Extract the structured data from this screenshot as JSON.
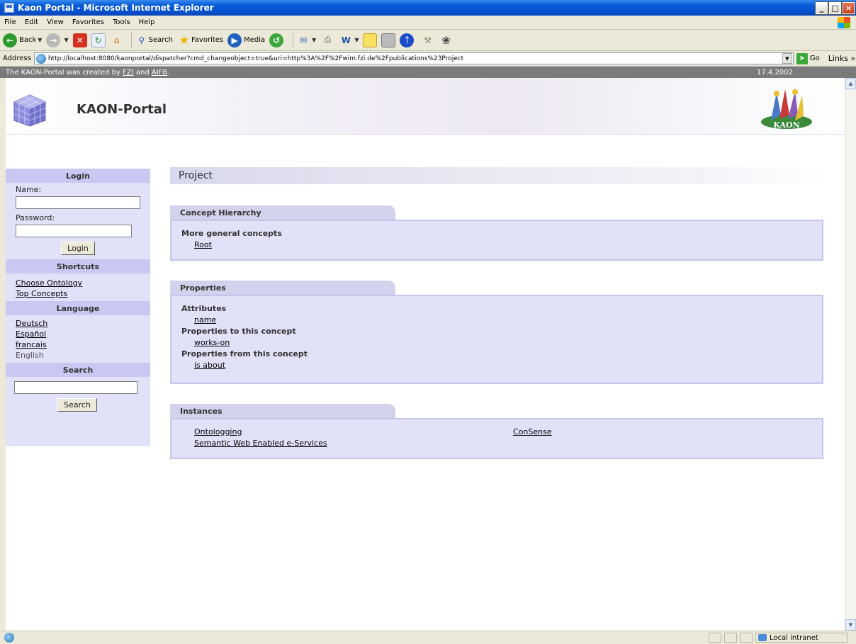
{
  "window": {
    "title": "Kaon Portal - Microsoft Internet Explorer",
    "buttons": [
      "_",
      "□",
      "×"
    ]
  },
  "menu": [
    "File",
    "Edit",
    "View",
    "Favorites",
    "Tools",
    "Help"
  ],
  "toolbar": {
    "back": "Back",
    "search": "Search",
    "favorites": "Favorites",
    "media": "Media"
  },
  "address": {
    "label": "Address",
    "url": "http://localhost:8080/kaonportal/dispatcher?cmd_changeobject=true&uri=http%3A%2F%2Fwim.fzi.de%2Fpublications%23Project",
    "go": "Go",
    "links": "Links »"
  },
  "strip": {
    "prefix": "The KAON-Portal was created by",
    "fzi": "FZI",
    "and": "and",
    "aifb": "AIFB",
    "suffix": ".",
    "date": "17.4.2002"
  },
  "header": {
    "brand": "KAON-Portal",
    "logo_text": "KAON"
  },
  "sidebar": {
    "login_head": "Login",
    "name_label": "Name:",
    "name_value": "",
    "password_label": "Password:",
    "password_value": "",
    "login_button": "Login",
    "shortcuts_head": "Shortcuts",
    "shortcuts": [
      "Choose Ontology",
      "Top Concepts"
    ],
    "language_head": "Language",
    "languages": [
      "Deutsch",
      "Español",
      "francais"
    ],
    "current_language": "English",
    "search_head": "Search",
    "search_value": "",
    "search_button": "Search"
  },
  "main": {
    "title": "Project",
    "hierarchy": {
      "tab": "Concept Hierarchy",
      "general_label": "More general concepts",
      "general_items": [
        "Root"
      ]
    },
    "properties": {
      "tab": "Properties",
      "attributes_label": "Attributes",
      "attributes": [
        "name"
      ],
      "to_label": "Properties to this concept",
      "to_items": [
        "works-on"
      ],
      "from_label": "Properties from this concept",
      "from_items": [
        "is about"
      ]
    },
    "instances": {
      "tab": "Instances",
      "items": [
        "Ontologging",
        "ConSense",
        "Semantic Web Enabled e-Services"
      ]
    }
  },
  "status": {
    "zone": "Local intranet"
  },
  "colors": {
    "title_bar": "#0a5fd8",
    "panel": "#e1e1f8",
    "panel_head": "#c8c8f2",
    "strip": "#7a7a7a"
  }
}
